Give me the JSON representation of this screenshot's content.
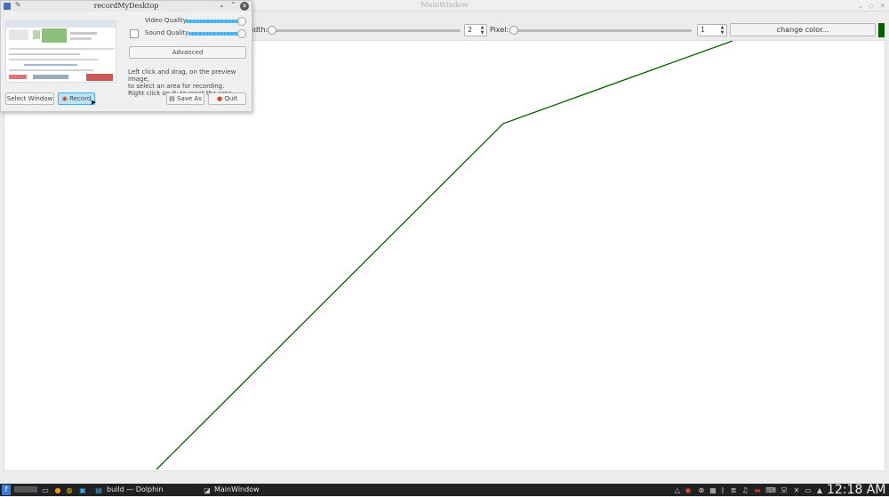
{
  "main_window": {
    "title": "MainWindow",
    "toolbar": {
      "width_label": "idth:",
      "width_value": "2",
      "pixel_label": "Pixel:",
      "pixel_value": "1",
      "color_button_label": "change color..."
    },
    "pen_color": "#0a5d00",
    "drawn_line": {
      "stroke": "#0a5d00",
      "points_description": "polyline"
    }
  },
  "rmd_dialog": {
    "title": "recordMyDesktop",
    "video_quality_label": "Video Quality",
    "sound_quality_label": "Sound Quality",
    "advanced_label": "Advanced",
    "help_text": "Left click and drag, on the preview image,\nto select an area for recording.\nRight click on it, to reset the area.",
    "select_window_label": "Select Window",
    "record_label": "Record",
    "save_as_label": "Save As",
    "quit_label": "Quit"
  },
  "taskbar": {
    "tasks": [
      "build — Dolphin",
      "MainWindow"
    ],
    "clock": "12:18 AM"
  }
}
